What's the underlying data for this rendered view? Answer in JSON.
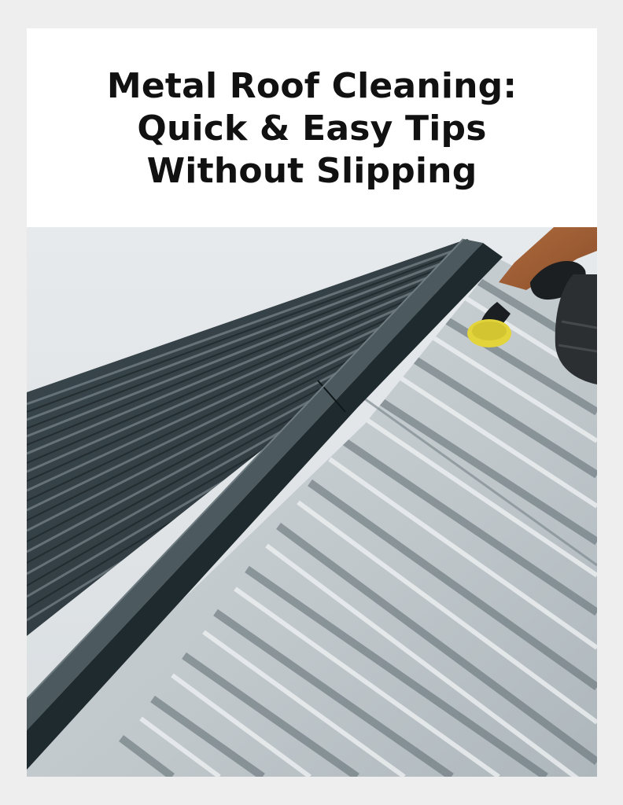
{
  "title_lines": [
    "Metal Roof Cleaning:",
    "Quick & Easy Tips",
    "Without Slipping"
  ],
  "image": {
    "subject": "metal-roof-cleaning-photo"
  },
  "colors": {
    "page_background": "#eeeeef",
    "card_background": "#ffffff",
    "title_text": "#111111",
    "sky": "#dfe3e6",
    "dark_roof": "#2f3b40",
    "ridge_cap": "#1f2a2e",
    "clean_roof": "#c9d0d4",
    "sponge": "#e2d43a",
    "glove": "#1c1f21"
  }
}
